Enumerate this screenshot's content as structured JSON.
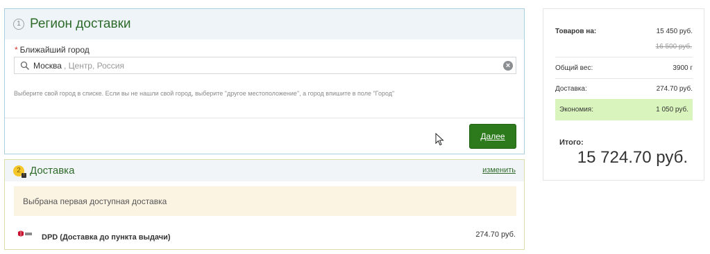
{
  "region": {
    "step": "1",
    "title": "Регион доставки",
    "field_required_mark": "*",
    "field_label": "Ближайший город",
    "city_value": "Москва",
    "city_suffix": ", Центр, Россия",
    "hint": "Выберите свой город в списке. Если вы не нашли свой город, выберите \"другое местоположение\", а город впишите в поле \"Город\"",
    "next_button": "Далее"
  },
  "delivery": {
    "step": "2",
    "title": "Доставка",
    "change_link": "изменить",
    "notice": "Выбрана первая доступная доставка",
    "service_name": "DPD (Доставка до пункта выдачи)",
    "service_price": "274.70 руб."
  },
  "summary": {
    "goods_label": "Товаров на:",
    "goods_value": "15 450 руб.",
    "goods_old_value": "16 500 руб.",
    "weight_label": "Общий вес:",
    "weight_value": "3900 г",
    "delivery_label": "Доставка:",
    "delivery_value": "274.70 руб.",
    "economy_label": "Экономия:",
    "economy_value": "1 050 руб.",
    "total_label": "Итого:",
    "total_value": "15 724.70 руб."
  },
  "icons": {
    "search": "search-icon",
    "clear": "clear-icon",
    "cursor": "cursor-icon",
    "dpd_logo": "dpd-logo-icon"
  },
  "colors": {
    "accent_green": "#2c7a1c",
    "title_green": "#2e6b2b",
    "economy_bg": "#d9f5bd",
    "notice_bg": "#fcf4e3"
  }
}
